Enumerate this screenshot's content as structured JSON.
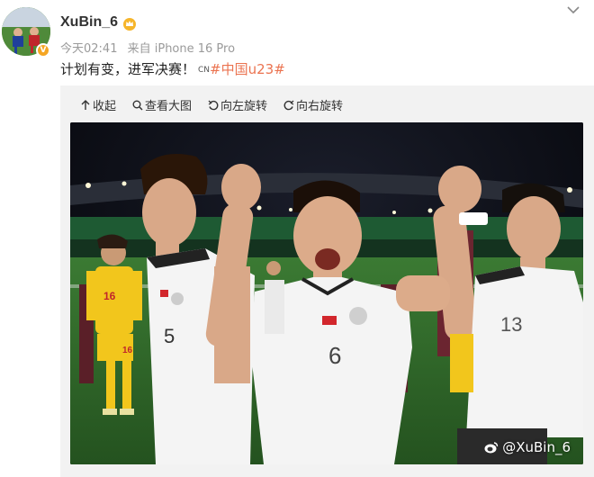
{
  "post": {
    "author": "XuBin_6",
    "verified_mark": "V",
    "time": "今天02:41",
    "source": "来自 iPhone 16 Pro",
    "text_main": "计划有变，进军决赛！",
    "text_tag_prefix": "CN",
    "hashtag": "#中国u23#"
  },
  "toolbar": {
    "collapse": "收起",
    "view_large": "查看大图",
    "rotate_left": "向左旋转",
    "rotate_right": "向右旋转"
  },
  "photo": {
    "watermark": "@XuBin_6",
    "jersey_numbers": [
      "16",
      "16",
      "5",
      "6",
      "13"
    ]
  },
  "colors": {
    "hashtag": "#eb7350",
    "meta_text": "#9a9a9a",
    "panel_bg": "#f2f2f2",
    "pitch": "#2f6b2a",
    "yellow_kit": "#f2c61c",
    "white_kit": "#f4f4f4"
  }
}
